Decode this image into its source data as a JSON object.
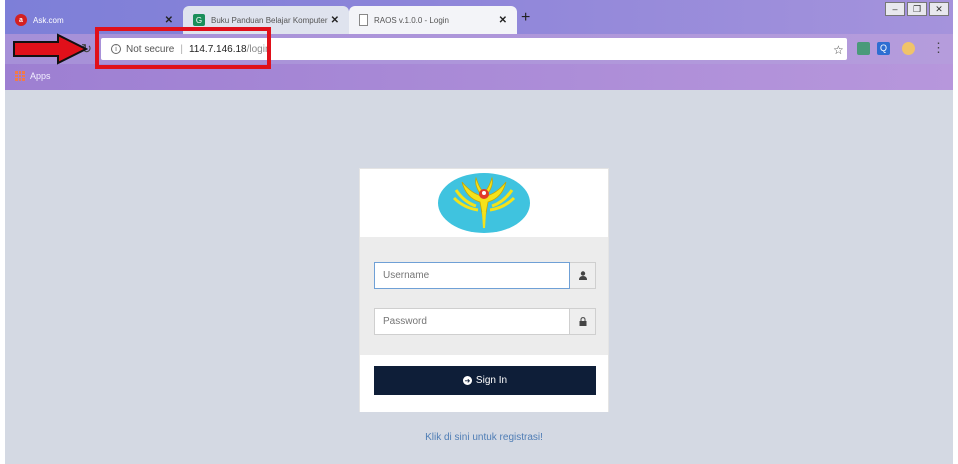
{
  "browser": {
    "tabs": [
      {
        "title": "Ask.com",
        "icon": "ask-icon"
      },
      {
        "title": "Buku Panduan Belajar Komputer",
        "icon": "g-icon"
      },
      {
        "title": "RAOS v.1.0.0 - Login",
        "icon": "document-icon"
      }
    ],
    "address": {
      "security": "Not secure",
      "host": "114.7.146.18",
      "path": "/login"
    },
    "bookmarks": {
      "apps_label": "Apps"
    }
  },
  "login": {
    "username_placeholder": "Username",
    "password_placeholder": "Password",
    "signin_label": "Sign In",
    "register_link": "Klik di sini untuk registrasi!"
  },
  "colors": {
    "signin_button": "#0e1e38",
    "page_background": "#d4d9e3",
    "annotation": "#e0101a"
  }
}
